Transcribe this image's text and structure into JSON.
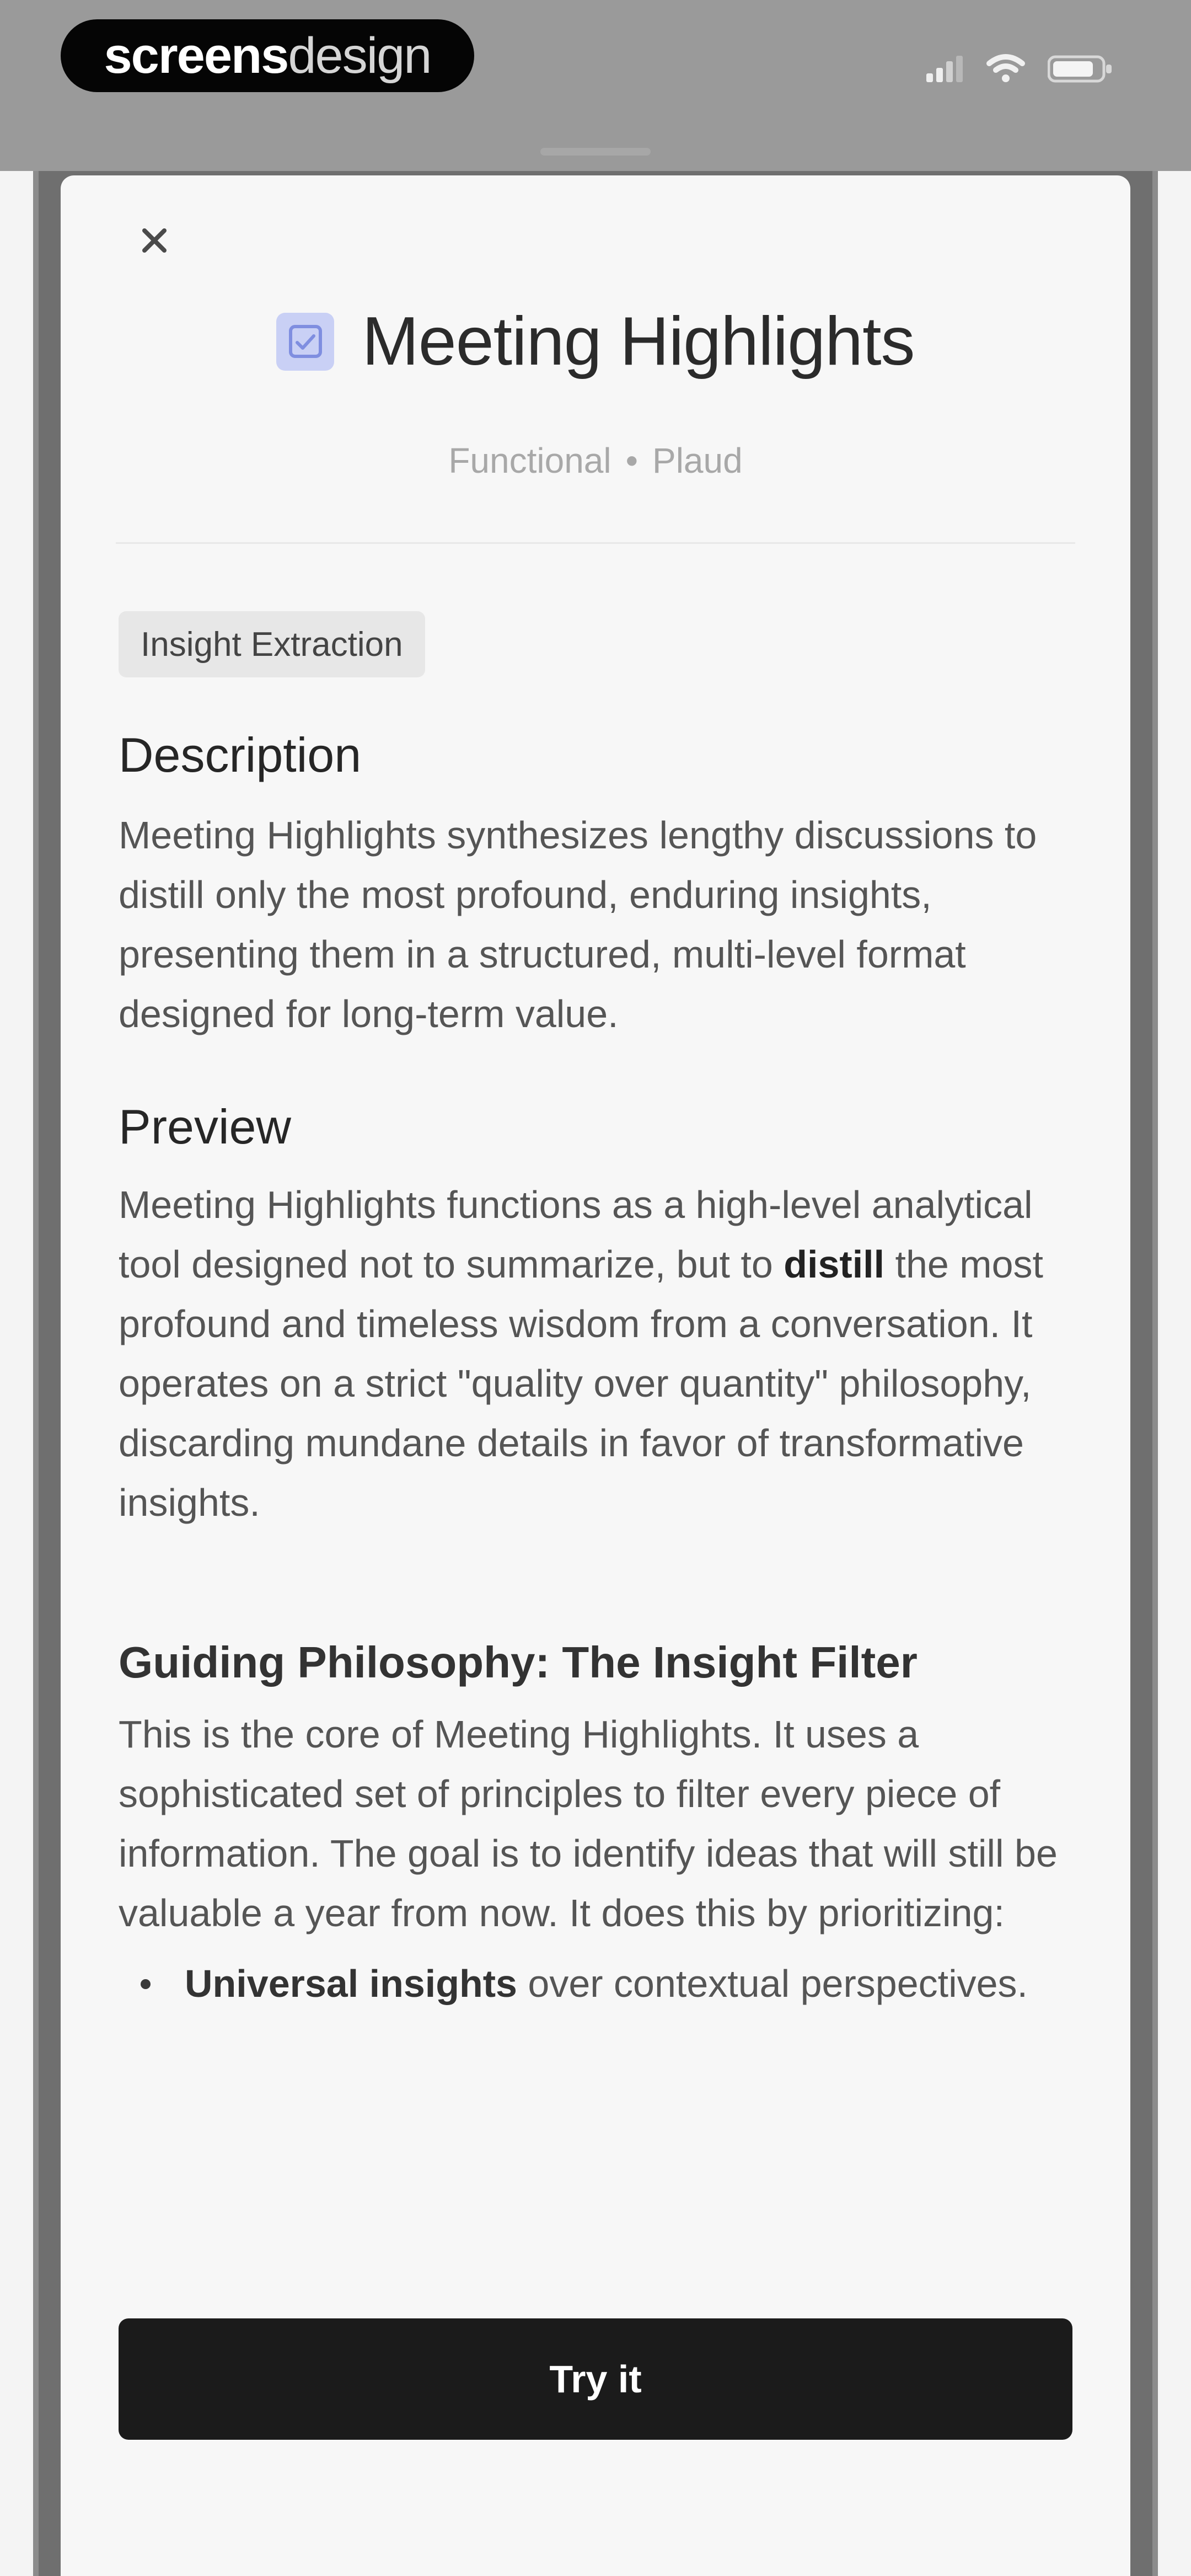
{
  "status_bar": {
    "brand": {
      "strong": "screens",
      "light": "design"
    }
  },
  "modal": {
    "close_label": "×",
    "title": "Meeting Highlights",
    "meta": {
      "category": "Functional",
      "separator": "•",
      "source": "Plaud"
    },
    "tag": "Insight Extraction",
    "description": {
      "heading": "Description",
      "text": "Meeting Highlights synthesizes lengthy discussions to distill only the most profound, enduring insights, presenting them in a structured, multi-level format designed for long-term value."
    },
    "preview": {
      "heading": "Preview",
      "text_before": "Meeting Highlights functions as a high-level analytical tool designed not to summarize, but to ",
      "text_bold": "distill",
      "text_after": " the most profound and timeless wisdom from a conversation. It operates on a strict \"quality over quantity\" philosophy, discarding mundane details in favor of transformative insights."
    },
    "philosophy": {
      "heading": "Guiding Philosophy: The Insight Filter",
      "text": "This is the core of Meeting Highlights. It uses a sophisticated set of principles to filter every piece of information. The goal is to identify ideas that will still be valuable a year from now. It does this by prioritizing:",
      "bullets": [
        {
          "bold": "Universal insights",
          "rest": " over contextual perspectives."
        }
      ]
    },
    "primary_button": "Try it"
  },
  "colors": {
    "title_icon_bg": "#c9d0f5",
    "button_bg": "#1b1b1b",
    "sheet_bg": "#f7f7f7"
  },
  "icons": {
    "close": "close-icon",
    "title": "checklist-icon"
  }
}
